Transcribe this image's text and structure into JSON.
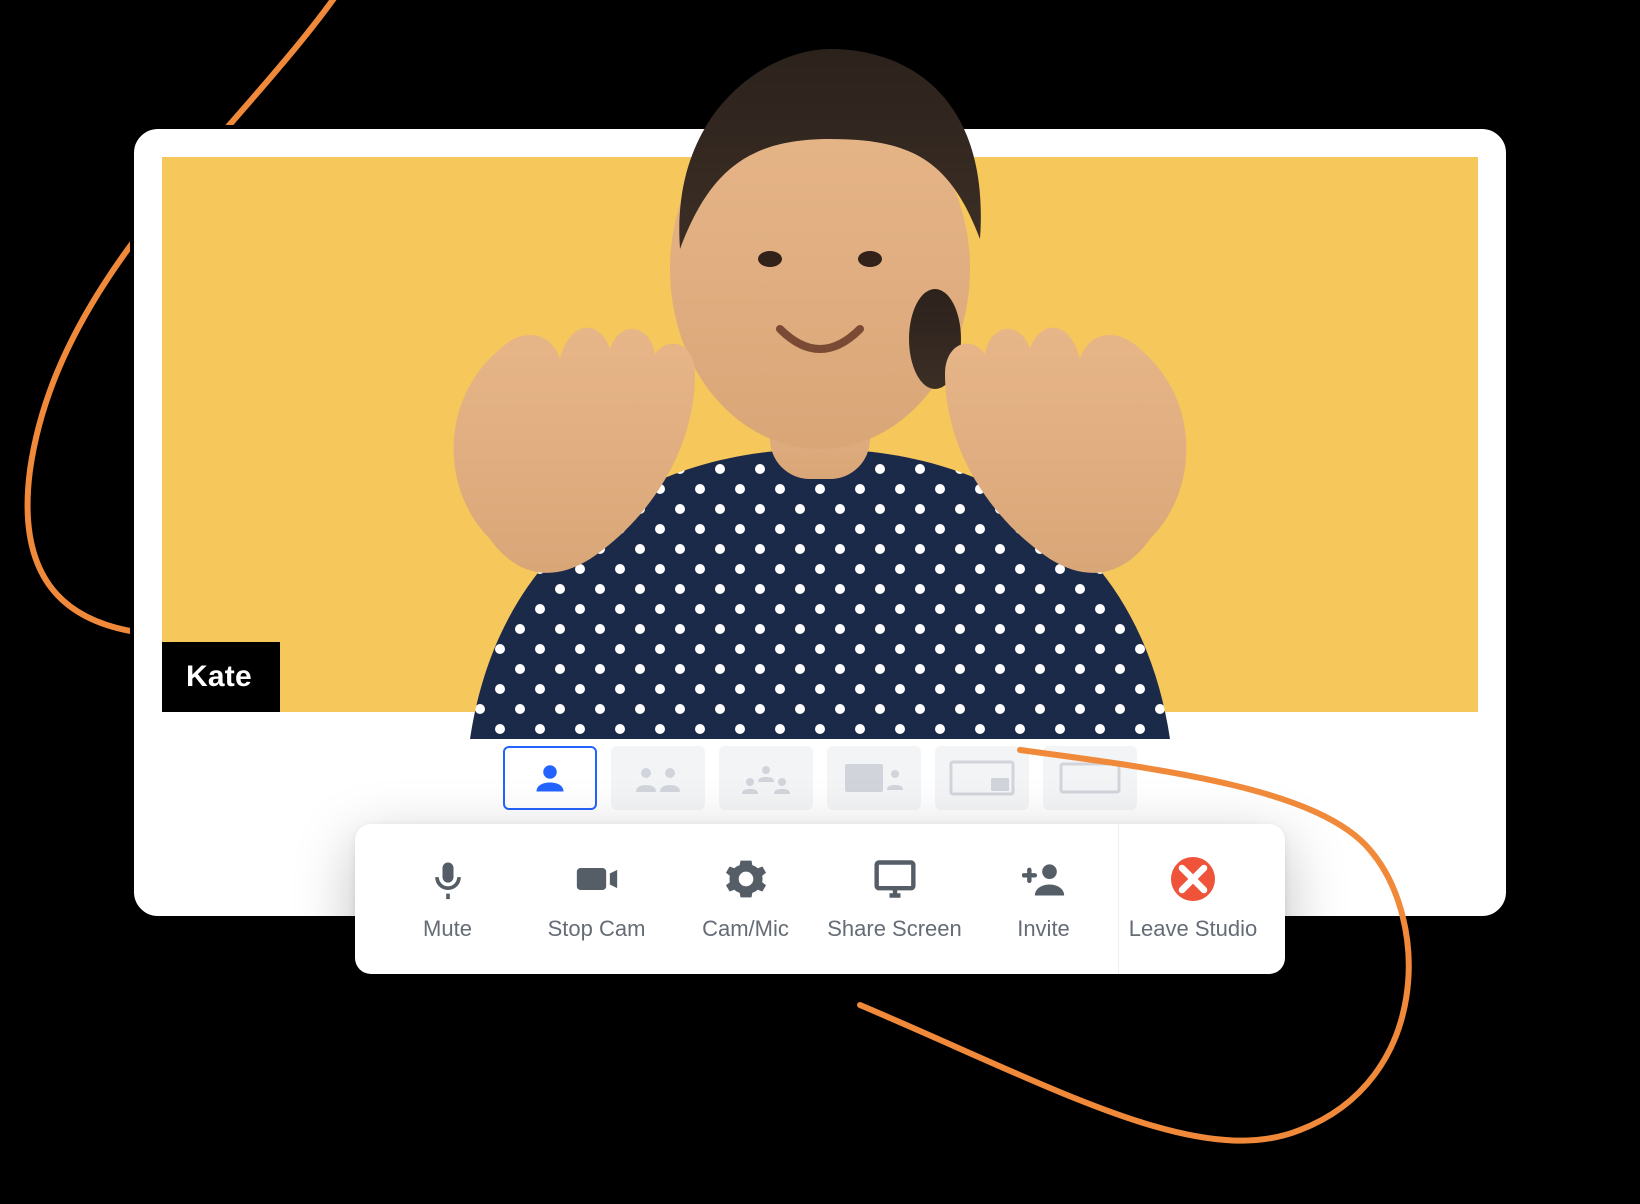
{
  "colors": {
    "accent": "#2563ff",
    "video_bg": "#f6c75a",
    "danger": "#ef5339",
    "squiggle": "#f08a3a"
  },
  "participant": {
    "name": "Kate"
  },
  "layouts": {
    "active_index": 0,
    "items": [
      {
        "id": "solo"
      },
      {
        "id": "two-up"
      },
      {
        "id": "three-up"
      },
      {
        "id": "pip"
      },
      {
        "id": "screen-pip"
      },
      {
        "id": "fullscreen"
      }
    ]
  },
  "toolbar": {
    "mute": {
      "label": "Mute",
      "icon": "mic-icon"
    },
    "cam": {
      "label": "Stop Cam",
      "icon": "camera-icon"
    },
    "device": {
      "label": "Cam/Mic",
      "icon": "gear-icon"
    },
    "share": {
      "label": "Share Screen",
      "icon": "monitor-icon"
    },
    "invite": {
      "label": "Invite",
      "icon": "add-user-icon"
    },
    "leave": {
      "label": "Leave Studio",
      "icon": "close-icon"
    }
  }
}
